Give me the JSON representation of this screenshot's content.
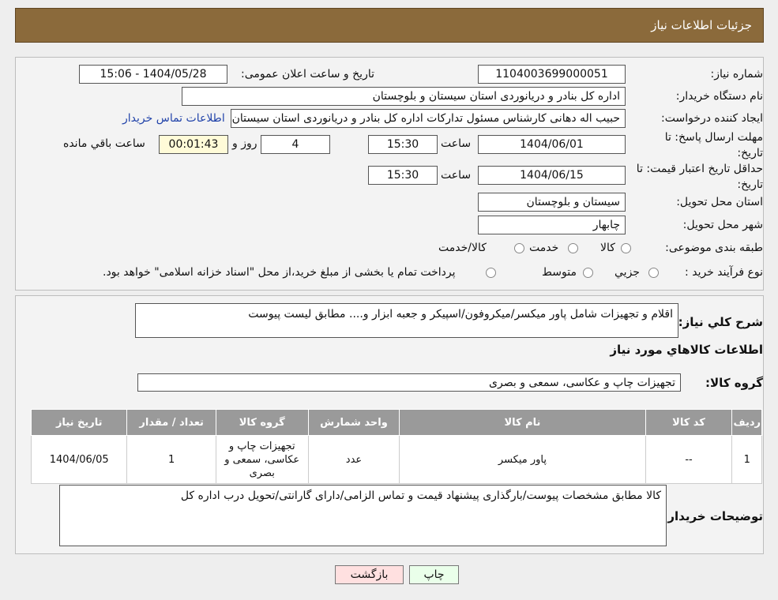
{
  "header": {
    "title": "جزئیات اطلاعات نیاز"
  },
  "info": {
    "need_no_label": "شماره نیاز:",
    "need_no": "1104003699000051",
    "announce_label": "تاریخ و ساعت اعلان عمومی:",
    "announce": "1404/05/28 - 15:06",
    "buyer_label": "نام دستگاه خریدار:",
    "buyer": "اداره کل بنادر و دریانوردی استان سیستان و بلوچستان",
    "creator_label": "ایجاد کننده درخواست:",
    "creator": "حبیب اله دهانی کارشناس مسئول تدارکات اداره کل بنادر و دریانوردی استان سیستان و بلوچستان",
    "contact_link": "اطلاعات تماس خریدار",
    "deadline_label": "مهلت ارسال پاسخ: تا تاریخ:",
    "deadline_date": "1404/06/01",
    "time_label": "ساعت",
    "deadline_time": "15:30",
    "days": "4",
    "days_label": "روز و",
    "remaining": "00:01:43",
    "remaining_label": "ساعت باقي مانده",
    "validity_label": "حداقل تاریخ اعتبار قیمت: تا تاریخ:",
    "validity_date": "1404/06/15",
    "validity_time": "15:30",
    "province_label": "استان محل تحویل:",
    "province": "سیستان و بلوچستان",
    "city_label": "شهر محل تحویل:",
    "city": "چابهار",
    "category_label": "طبقه بندی موضوعی:",
    "cat_options": [
      "کالا",
      "خدمت",
      "کالا/خدمت"
    ],
    "process_label": "نوع فرآیند خرید :",
    "process_options": [
      "جزيي",
      "متوسط"
    ],
    "process_note": "پرداخت تمام یا بخشی از مبلغ خرید،از محل \"اسناد خزانه اسلامی\" خواهد بود."
  },
  "desc": {
    "label": "شرح کلي نياز:",
    "text": "اقلام و تجهیزات شامل پاور میکسر/میکروفون/اسپیکر و جعبه ابزار و.... مطابق لیست پیوست",
    "items_title": "اطلاعات کالاهاي مورد نياز",
    "group_label": "گروه کالا:",
    "group": "تجهیزات چاپ و عکاسی، سمعی و بصری"
  },
  "table": {
    "headers": [
      "رديف",
      "کد کالا",
      "نام کالا",
      "واحد شمارش",
      "گروه کالا",
      "تعداد / مقدار",
      "تاریخ نیاز"
    ],
    "rows": [
      [
        "1",
        "--",
        "پاور میکسر",
        "عدد",
        "تجهیزات چاپ و عکاسی، سمعی و بصری",
        "1",
        "1404/06/05"
      ]
    ]
  },
  "notes": {
    "label": "توضیحات خریدار:",
    "text": "کالا مطابق مشخصات پیوست/بارگذاری پیشنهاد قیمت و تماس الزامی/دارای گارانتی/تحویل درب اداره کل"
  },
  "buttons": {
    "print": "چاپ",
    "back": "بازگشت"
  },
  "colors": {
    "header": "#8b6a3b",
    "table_header": "#9a9a9a",
    "back_button": "#ffe0e0",
    "print_button": "#eaffea"
  }
}
